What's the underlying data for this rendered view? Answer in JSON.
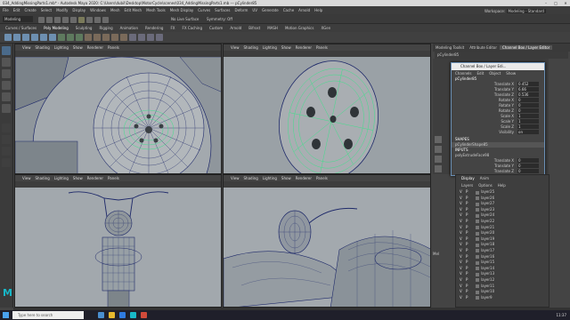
{
  "window": {
    "title": "034_AddingMissingParts1.mb* - Autodesk Maya 2020: C:\\Users\\dubil\\Desktop\\MotorCycle\\scenes\\034_AddingMissingParts1.mb --- pCylinder85"
  },
  "menubar": {
    "items": [
      "File",
      "Edit",
      "Create",
      "Select",
      "Modify",
      "Display",
      "Windows",
      "Mesh",
      "Edit Mesh",
      "Mesh Tools",
      "Mesh Display",
      "Curves",
      "Surfaces",
      "Deform",
      "UV",
      "Generate",
      "Cache",
      "Arnold",
      "Help"
    ],
    "workspace_label": "Workspace:",
    "workspace_value": "Modeling - Standard"
  },
  "statusline": {
    "mode": "Modeling",
    "live_surface": "No Live Surface",
    "symmetry": "Symmetry: Off"
  },
  "shelf": {
    "tabs": [
      "Curves / Surfaces",
      "Poly Modeling",
      "Sculpting",
      "Rigging",
      "Animation",
      "Rendering",
      "FX",
      "FX Caching",
      "Custom",
      "Arnold",
      "Bifrost",
      "MASH",
      "Motion Graphics",
      "XGen"
    ]
  },
  "viewports": {
    "menu": [
      "View",
      "Shading",
      "Lighting",
      "Show",
      "Renderer",
      "Panels"
    ]
  },
  "sidepanel": {
    "tabs": [
      "Modeling Toolkit",
      "Attribute Editor",
      "Channel Box / Layer Editor"
    ],
    "active": "Channel Box / Layer Editor",
    "object_name": "pCylinder85"
  },
  "channel_box": {
    "title": "Channel Box / Layer Edi...",
    "menu": [
      "Channels",
      "Edit",
      "Object",
      "Show"
    ],
    "object": "pCylinder85",
    "channels": [
      {
        "label": "Translate X",
        "value": "0.452"
      },
      {
        "label": "Translate Y",
        "value": "6.66"
      },
      {
        "label": "Translate Z",
        "value": "0.536"
      },
      {
        "label": "Rotate X",
        "value": "0"
      },
      {
        "label": "Rotate Y",
        "value": "0"
      },
      {
        "label": "Rotate Z",
        "value": "0"
      },
      {
        "label": "Scale X",
        "value": "1"
      },
      {
        "label": "Scale Y",
        "value": "1"
      },
      {
        "label": "Scale Z",
        "value": "1"
      },
      {
        "label": "Visibility",
        "value": "on"
      }
    ],
    "shapes_header": "SHAPES",
    "shape_name": "pCylinderShape85",
    "inputs_header": "INPUTS",
    "input_name": "polyExtrudeFace98",
    "input_channels": [
      {
        "label": "Translate X",
        "value": "0"
      },
      {
        "label": "Translate Y",
        "value": "0"
      },
      {
        "label": "Translate Z",
        "value": "0"
      }
    ]
  },
  "layer_editor": {
    "tabs": [
      "Display",
      "Anim"
    ],
    "menu": [
      "Layers",
      "Options",
      "Help"
    ],
    "layers": [
      {
        "v": "V",
        "p": "P",
        "name": "layer25"
      },
      {
        "v": "V",
        "p": "P",
        "name": "layer26"
      },
      {
        "v": "V",
        "p": "P",
        "name": "layer27"
      },
      {
        "v": "V",
        "p": "P",
        "name": "layer23"
      },
      {
        "v": "V",
        "p": "P",
        "name": "layer24"
      },
      {
        "v": "V",
        "p": "P",
        "name": "layer22"
      },
      {
        "v": "V",
        "p": "P",
        "name": "layer21"
      },
      {
        "v": "V",
        "p": "P",
        "name": "layer20"
      },
      {
        "v": "V",
        "p": "P",
        "name": "layer19"
      },
      {
        "v": "V",
        "p": "P",
        "name": "layer18"
      },
      {
        "v": "V",
        "p": "P",
        "name": "layer17"
      },
      {
        "v": "V",
        "p": "P",
        "name": "layer16"
      },
      {
        "v": "V",
        "p": "P",
        "name": "layer15"
      },
      {
        "v": "V",
        "p": "P",
        "name": "layer14"
      },
      {
        "v": "V",
        "p": "P",
        "name": "layer13"
      },
      {
        "v": "V",
        "p": "P",
        "name": "layer12"
      },
      {
        "v": "V",
        "p": "P",
        "name": "layer11"
      },
      {
        "v": "V",
        "p": "P",
        "name": "layer10"
      },
      {
        "v": "V",
        "p": "P",
        "name": "layer9"
      }
    ]
  },
  "script_label": "Mel",
  "helpline": "",
  "taskbar": {
    "search_placeholder": "Type here to search",
    "clock": "11:37"
  },
  "logo": "M"
}
